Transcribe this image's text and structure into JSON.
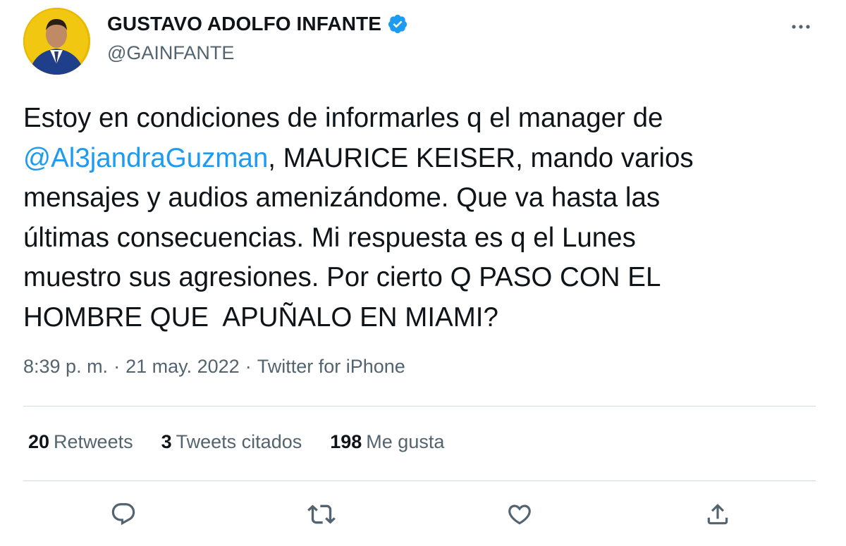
{
  "author": {
    "display_name": "GUSTAVO ADOLFO INFANTE",
    "handle": "@GAINFANTE",
    "verified": true
  },
  "tweet": {
    "lines": [
      [
        {
          "text": "Estoy en condiciones de informarles q el manager de",
          "mention": false
        }
      ],
      [
        {
          "text": "@Al3jandraGuzman",
          "mention": true
        },
        {
          "text": ", MAURICE KEISER, mando varios",
          "mention": false
        }
      ],
      [
        {
          "text": "mensajes y audios amenizándome. Que va hasta las",
          "mention": false
        }
      ],
      [
        {
          "text": "últimas consecuencias. Mi respuesta es q el Lunes",
          "mention": false
        }
      ],
      [
        {
          "text": "muestro sus agresiones. Por cierto Q PASO CON EL",
          "mention": false
        }
      ],
      [
        {
          "text": "HOMBRE QUE  APUÑALO EN MIAMI?",
          "mention": false
        }
      ]
    ]
  },
  "meta": {
    "time": "8:39 p. m.",
    "separator": "·",
    "date": "21 may. 2022",
    "source": "Twitter for iPhone"
  },
  "stats": {
    "retweets": {
      "count": "20",
      "label": "Retweets"
    },
    "quotes": {
      "count": "3",
      "label": "Tweets citados"
    },
    "likes": {
      "count": "198",
      "label": "Me gusta"
    }
  },
  "icons": {
    "more": "more-horizontal-icon",
    "reply": "reply-bubble-icon",
    "retweet": "retweet-icon",
    "like": "heart-icon",
    "share": "share-icon",
    "verified": "verified-badge-icon"
  },
  "colors": {
    "accent": "#1d9bf0",
    "text": "#0f1419",
    "muted": "#536471",
    "divider": "#cfd9de"
  }
}
